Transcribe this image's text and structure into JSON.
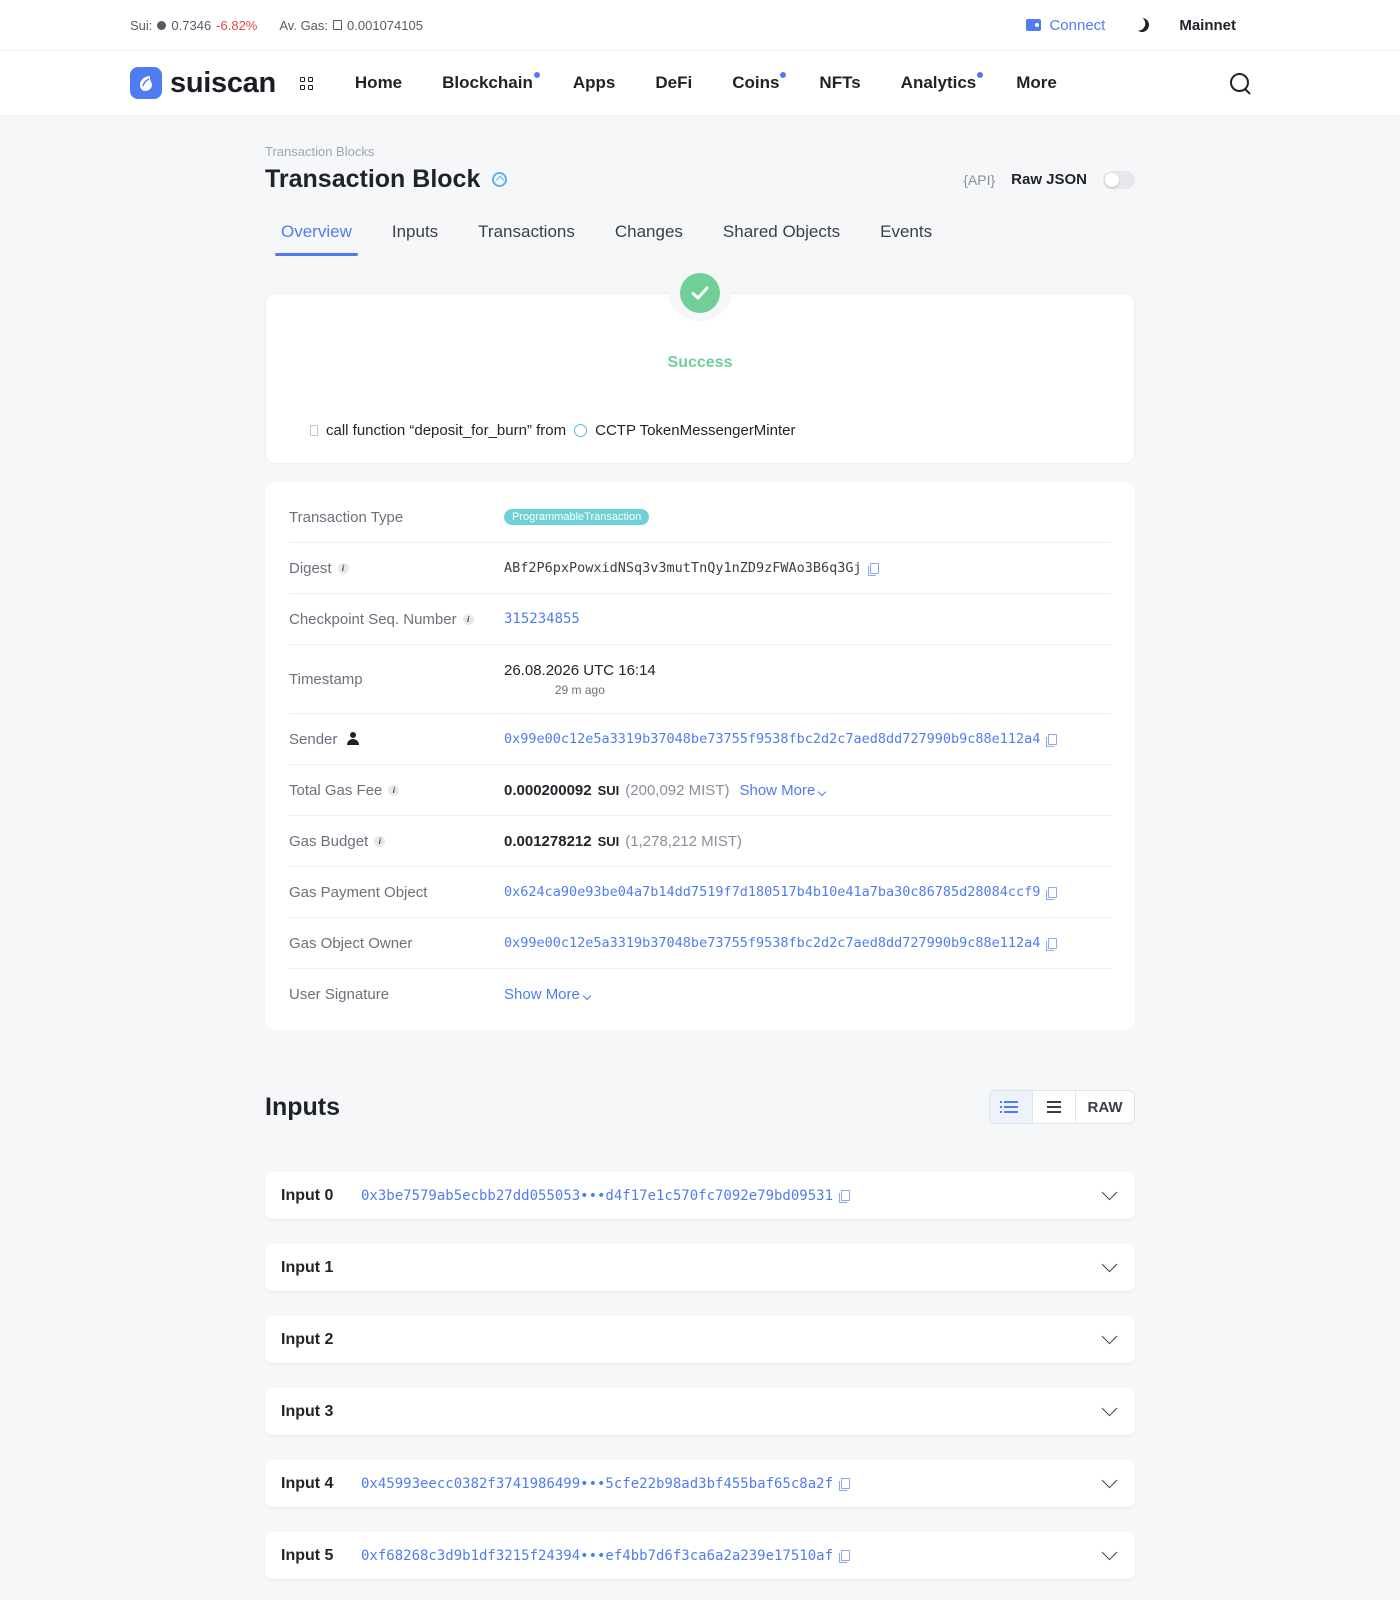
{
  "topbar": {
    "sui_label": "Sui:",
    "sui_price": "0.7346",
    "sui_change": "-6.82%",
    "gas_label": "Av. Gas:",
    "gas_value": "0.001074105",
    "connect": "Connect",
    "network": "Mainnet"
  },
  "nav": {
    "logo": "suiscan",
    "items": [
      {
        "label": "Home",
        "dot": false
      },
      {
        "label": "Blockchain",
        "dot": true
      },
      {
        "label": "Apps",
        "dot": false
      },
      {
        "label": "DeFi",
        "dot": false
      },
      {
        "label": "Coins",
        "dot": true
      },
      {
        "label": "NFTs",
        "dot": false
      },
      {
        "label": "Analytics",
        "dot": true
      },
      {
        "label": "More",
        "dot": false
      }
    ]
  },
  "page": {
    "breadcrumb": "Transaction Blocks",
    "title": "Transaction Block",
    "api_label": "{API}",
    "raw_json_label": "Raw JSON",
    "tabs": [
      "Overview",
      "Inputs",
      "Transactions",
      "Changes",
      "Shared Objects",
      "Events"
    ]
  },
  "status": {
    "text": "Success",
    "call_prefix": "call function “deposit_for_burn” from",
    "package": "CCTP TokenMessengerMinter"
  },
  "details": {
    "tx_type_label": "Transaction Type",
    "tx_type_value": "ProgrammableTransaction",
    "digest_label": "Digest",
    "digest_value": "ABf2P6pxPowxidNSq3v3mutTnQy1nZD9zFWAo3B6q3Gj",
    "checkpoint_label": "Checkpoint Seq. Number",
    "checkpoint_value": "315234855",
    "timestamp_label": "Timestamp",
    "timestamp_value": "26.08.2026 UTC 16:14",
    "timestamp_ago": "29 m ago",
    "sender_label": "Sender",
    "sender_value": "0x99e00c12e5a3319b37048be73755f9538fbc2d2c7aed8dd727990b9c88e112a4",
    "gas_fee_label": "Total Gas Fee",
    "gas_fee_value": "0.000200092",
    "gas_fee_unit": "SUI",
    "gas_fee_mist": "(200,092 MIST)",
    "show_more": "Show More",
    "gas_budget_label": "Gas Budget",
    "gas_budget_value": "0.001278212",
    "gas_budget_unit": "SUI",
    "gas_budget_mist": "(1,278,212 MIST)",
    "gas_payment_label": "Gas Payment Object",
    "gas_payment_value": "0x624ca90e93be04a7b14dd7519f7d180517b4b10e41a7ba30c86785d28084ccf9",
    "gas_owner_label": "Gas Object Owner",
    "gas_owner_value": "0x99e00c12e5a3319b37048be73755f9538fbc2d2c7aed8dd727990b9c88e112a4",
    "user_sig_label": "User Signature",
    "user_sig_show_more": "Show More"
  },
  "inputs": {
    "title": "Inputs",
    "raw_label": "RAW",
    "items": [
      {
        "name": "Input 0",
        "addr": "0x3be7579ab5ecbb27dd055053•••d4f17e1c570fc7092e79bd09531"
      },
      {
        "name": "Input 1",
        "addr": ""
      },
      {
        "name": "Input 2",
        "addr": ""
      },
      {
        "name": "Input 3",
        "addr": ""
      },
      {
        "name": "Input 4",
        "addr": "0x45993eecc0382f3741986499•••5cfe22b98ad3bf455baf65c8a2f"
      },
      {
        "name": "Input 5",
        "addr": "0xf68268c3d9b1df3215f24394•••ef4bb7d6f3ca6a2a239e17510af"
      }
    ]
  }
}
